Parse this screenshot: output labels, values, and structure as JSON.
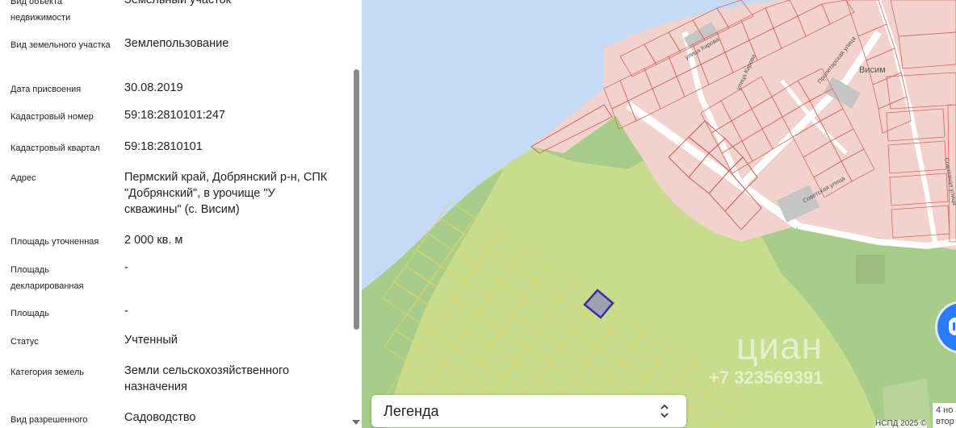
{
  "info_panel": {
    "rows": [
      {
        "label": "Вид объекта недвижимости",
        "value": "Земельный участок"
      },
      {
        "label": "Вид земельного участка",
        "value": "Землепользование"
      },
      {
        "label": "Дата присвоения",
        "value": "30.08.2019"
      },
      {
        "label": "Кадастровый номер",
        "value": "59:18:2810101:247"
      },
      {
        "label": "Кадастровый квартал",
        "value": "59:18:2810101"
      },
      {
        "label": "Адрес",
        "value": "Пермский край, Добрянский р-н, СПК \"Добрянский\", в урочище \"У скважины\" (с. Висим)"
      },
      {
        "label": "Площадь уточненная",
        "value": "2 000 кв. м"
      },
      {
        "label": "Площадь декларированная",
        "value": "-"
      },
      {
        "label": "Площадь",
        "value": "-"
      },
      {
        "label": "Статус",
        "value": "Учтенный"
      },
      {
        "label": "Категория земель",
        "value": "Земли сельскохозяйственного назначения"
      },
      {
        "label": "Вид разрешенного",
        "value": "Садоводство"
      }
    ]
  },
  "map": {
    "village_label": "Висим",
    "street_labels": [
      "улица Кирова",
      "улица Кирова",
      "Пролетарская улица",
      "Советская улица",
      "Совхозная улица"
    ],
    "legend_label": "Легенда",
    "watermark_brand": "циан",
    "watermark_phone": "+7 323569391",
    "scale_text": "4 но",
    "scale_text2": "втор",
    "attribution": "НСПД 2025 ©",
    "colors": {
      "water": "#c3dbf5",
      "land": "#c7dc8c",
      "forest": "#a8cd8a",
      "parcel_outline": "#e9d15a",
      "selected_parcel": "#3d2f9a",
      "built_area": "#f2d2cc",
      "building_outline": "#d9665e",
      "road": "#ffffff"
    },
    "icons": [
      "chevron-up-down-icon",
      "cian-bubble-icon"
    ]
  }
}
